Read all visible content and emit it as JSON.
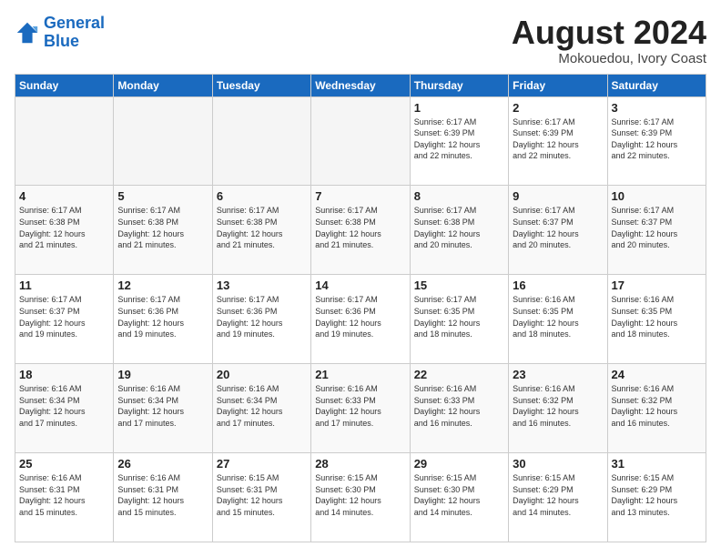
{
  "logo": {
    "line1": "General",
    "line2": "Blue"
  },
  "title": "August 2024",
  "subtitle": "Mokouedou, Ivory Coast",
  "days_header": [
    "Sunday",
    "Monday",
    "Tuesday",
    "Wednesday",
    "Thursday",
    "Friday",
    "Saturday"
  ],
  "weeks": [
    [
      {
        "num": "",
        "info": ""
      },
      {
        "num": "",
        "info": ""
      },
      {
        "num": "",
        "info": ""
      },
      {
        "num": "",
        "info": ""
      },
      {
        "num": "1",
        "info": "Sunrise: 6:17 AM\nSunset: 6:39 PM\nDaylight: 12 hours\nand 22 minutes."
      },
      {
        "num": "2",
        "info": "Sunrise: 6:17 AM\nSunset: 6:39 PM\nDaylight: 12 hours\nand 22 minutes."
      },
      {
        "num": "3",
        "info": "Sunrise: 6:17 AM\nSunset: 6:39 PM\nDaylight: 12 hours\nand 22 minutes."
      }
    ],
    [
      {
        "num": "4",
        "info": "Sunrise: 6:17 AM\nSunset: 6:38 PM\nDaylight: 12 hours\nand 21 minutes."
      },
      {
        "num": "5",
        "info": "Sunrise: 6:17 AM\nSunset: 6:38 PM\nDaylight: 12 hours\nand 21 minutes."
      },
      {
        "num": "6",
        "info": "Sunrise: 6:17 AM\nSunset: 6:38 PM\nDaylight: 12 hours\nand 21 minutes."
      },
      {
        "num": "7",
        "info": "Sunrise: 6:17 AM\nSunset: 6:38 PM\nDaylight: 12 hours\nand 21 minutes."
      },
      {
        "num": "8",
        "info": "Sunrise: 6:17 AM\nSunset: 6:38 PM\nDaylight: 12 hours\nand 20 minutes."
      },
      {
        "num": "9",
        "info": "Sunrise: 6:17 AM\nSunset: 6:37 PM\nDaylight: 12 hours\nand 20 minutes."
      },
      {
        "num": "10",
        "info": "Sunrise: 6:17 AM\nSunset: 6:37 PM\nDaylight: 12 hours\nand 20 minutes."
      }
    ],
    [
      {
        "num": "11",
        "info": "Sunrise: 6:17 AM\nSunset: 6:37 PM\nDaylight: 12 hours\nand 19 minutes."
      },
      {
        "num": "12",
        "info": "Sunrise: 6:17 AM\nSunset: 6:36 PM\nDaylight: 12 hours\nand 19 minutes."
      },
      {
        "num": "13",
        "info": "Sunrise: 6:17 AM\nSunset: 6:36 PM\nDaylight: 12 hours\nand 19 minutes."
      },
      {
        "num": "14",
        "info": "Sunrise: 6:17 AM\nSunset: 6:36 PM\nDaylight: 12 hours\nand 19 minutes."
      },
      {
        "num": "15",
        "info": "Sunrise: 6:17 AM\nSunset: 6:35 PM\nDaylight: 12 hours\nand 18 minutes."
      },
      {
        "num": "16",
        "info": "Sunrise: 6:16 AM\nSunset: 6:35 PM\nDaylight: 12 hours\nand 18 minutes."
      },
      {
        "num": "17",
        "info": "Sunrise: 6:16 AM\nSunset: 6:35 PM\nDaylight: 12 hours\nand 18 minutes."
      }
    ],
    [
      {
        "num": "18",
        "info": "Sunrise: 6:16 AM\nSunset: 6:34 PM\nDaylight: 12 hours\nand 17 minutes."
      },
      {
        "num": "19",
        "info": "Sunrise: 6:16 AM\nSunset: 6:34 PM\nDaylight: 12 hours\nand 17 minutes."
      },
      {
        "num": "20",
        "info": "Sunrise: 6:16 AM\nSunset: 6:34 PM\nDaylight: 12 hours\nand 17 minutes."
      },
      {
        "num": "21",
        "info": "Sunrise: 6:16 AM\nSunset: 6:33 PM\nDaylight: 12 hours\nand 17 minutes."
      },
      {
        "num": "22",
        "info": "Sunrise: 6:16 AM\nSunset: 6:33 PM\nDaylight: 12 hours\nand 16 minutes."
      },
      {
        "num": "23",
        "info": "Sunrise: 6:16 AM\nSunset: 6:32 PM\nDaylight: 12 hours\nand 16 minutes."
      },
      {
        "num": "24",
        "info": "Sunrise: 6:16 AM\nSunset: 6:32 PM\nDaylight: 12 hours\nand 16 minutes."
      }
    ],
    [
      {
        "num": "25",
        "info": "Sunrise: 6:16 AM\nSunset: 6:31 PM\nDaylight: 12 hours\nand 15 minutes."
      },
      {
        "num": "26",
        "info": "Sunrise: 6:16 AM\nSunset: 6:31 PM\nDaylight: 12 hours\nand 15 minutes."
      },
      {
        "num": "27",
        "info": "Sunrise: 6:15 AM\nSunset: 6:31 PM\nDaylight: 12 hours\nand 15 minutes."
      },
      {
        "num": "28",
        "info": "Sunrise: 6:15 AM\nSunset: 6:30 PM\nDaylight: 12 hours\nand 14 minutes."
      },
      {
        "num": "29",
        "info": "Sunrise: 6:15 AM\nSunset: 6:30 PM\nDaylight: 12 hours\nand 14 minutes."
      },
      {
        "num": "30",
        "info": "Sunrise: 6:15 AM\nSunset: 6:29 PM\nDaylight: 12 hours\nand 14 minutes."
      },
      {
        "num": "31",
        "info": "Sunrise: 6:15 AM\nSunset: 6:29 PM\nDaylight: 12 hours\nand 13 minutes."
      }
    ]
  ]
}
